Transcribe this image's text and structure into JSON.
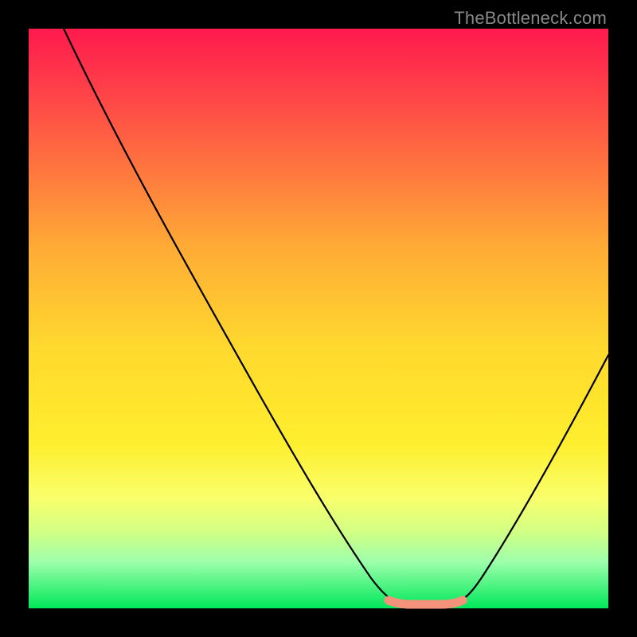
{
  "watermark": "TheBottleneck.com",
  "chart_data": {
    "type": "line",
    "title": "",
    "xlabel": "",
    "ylabel": "",
    "xlim": [
      0,
      100
    ],
    "ylim": [
      0,
      100
    ],
    "grid": false,
    "series": [
      {
        "name": "curve",
        "x": [
          6,
          20,
          35,
          50,
          59,
          63,
          67,
          73,
          78,
          85,
          92,
          100
        ],
        "y": [
          100,
          73,
          46,
          20,
          6,
          2,
          0.5,
          0.5,
          2,
          10,
          25,
          45
        ]
      }
    ],
    "markers": {
      "name": "highlight-band",
      "x": [
        63,
        73
      ],
      "y": [
        0.5,
        0.5
      ],
      "color": "#f5927b"
    },
    "background_gradient": {
      "top": "#ff1a4e",
      "bottom": "#00e85a"
    }
  }
}
